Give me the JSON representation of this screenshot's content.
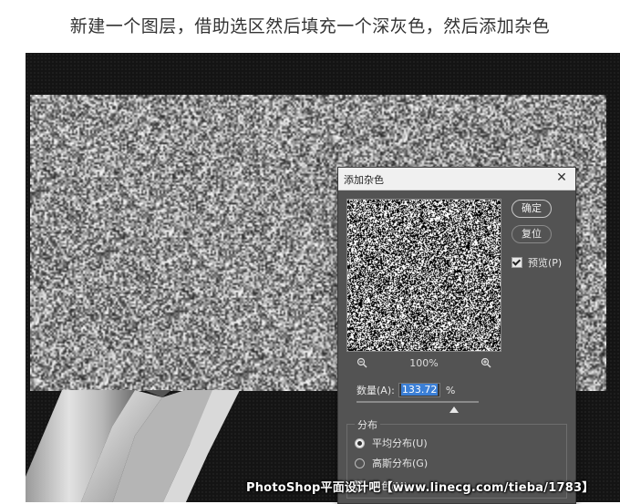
{
  "caption": "新建一个图层，借助选区然后填充一个深灰色，然后添加杂色",
  "dialog": {
    "title": "添加杂色",
    "ok_label": "确定",
    "reset_label": "复位",
    "preview_label": "预览(P)",
    "preview_checked": true,
    "zoom_level": "100%",
    "amount_label": "数量(A):",
    "amount_value": "133.72",
    "amount_unit": "%",
    "amount_fraction": 0.8,
    "distribution_label": "分布",
    "distribution_options": [
      "平均分布(U)",
      "高斯分布(G)",
      "单色(M)"
    ],
    "distribution_selected": 0
  },
  "watermark": "PhotoShop平面设计吧【www.linecg.com/tieba/1783】",
  "icons": {
    "close": "close-icon",
    "zoom_out": "zoom-out-icon",
    "zoom_in": "zoom-in-icon"
  },
  "colors": {
    "dialog_bg": "#535353",
    "canvas_bg": "#141414",
    "accent": "#3b7fd6"
  }
}
